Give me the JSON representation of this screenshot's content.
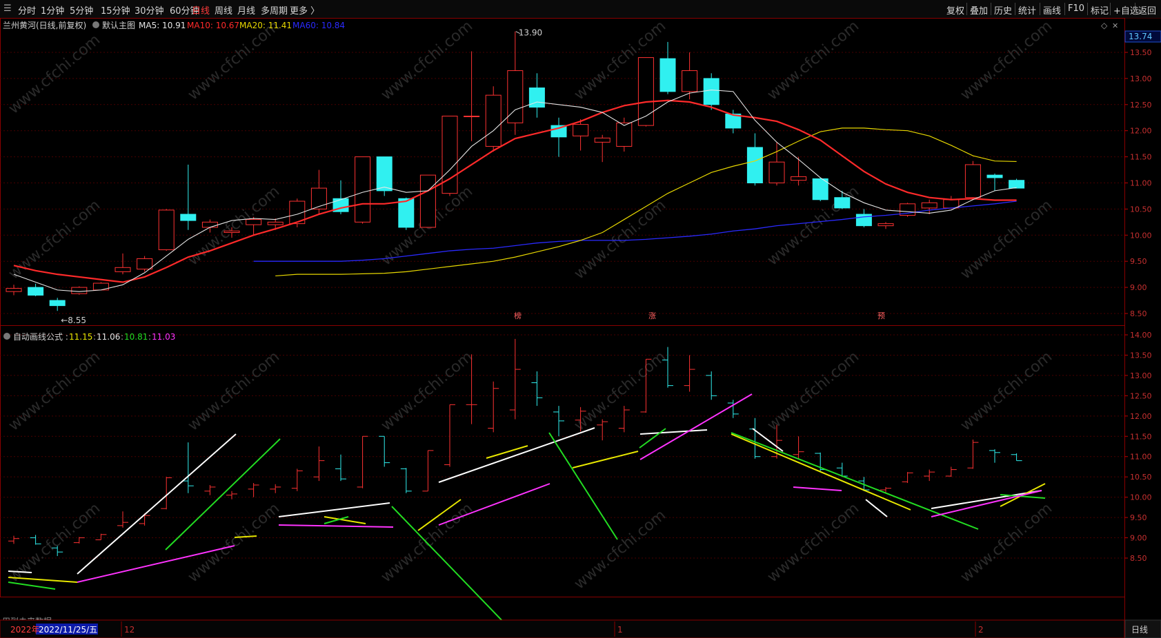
{
  "toolbar": {
    "timeframes": [
      {
        "label": "分时",
        "active": false
      },
      {
        "label": "1分钟",
        "active": false
      },
      {
        "label": "5分钟",
        "active": false
      },
      {
        "label": "15分钟",
        "active": false
      },
      {
        "label": "30分钟",
        "active": false
      },
      {
        "label": "60分钟",
        "active": false
      },
      {
        "label": "日线",
        "active": true
      },
      {
        "label": "周线",
        "active": false
      },
      {
        "label": "月线",
        "active": false
      },
      {
        "label": "多周期",
        "active": false
      },
      {
        "label": "更多 〉",
        "active": false
      }
    ],
    "right_buttons": [
      "复权",
      "叠加",
      "历史",
      "统计",
      "画线",
      "F10",
      "标记",
      "+自选",
      "返回"
    ]
  },
  "main_panel": {
    "title": "兰州黄河(日线,前复权)",
    "template_label": "默认主图",
    "ma": [
      {
        "label": "MA5: 10.91",
        "color": "#e6e6e6"
      },
      {
        "label": "MA10: 10.67",
        "color": "#ff2a2a"
      },
      {
        "label": "MA20: 11.41",
        "color": "#e8d800"
      },
      {
        "label": "MA60: 10.84",
        "color": "#2a2aff"
      }
    ],
    "current_price": "13.74",
    "price_axis": [
      "13.50",
      "13.00",
      "12.50",
      "12.00",
      "11.50",
      "11.00",
      "10.50",
      "10.00",
      "9.50",
      "9.00",
      "8.50"
    ],
    "high_label": "13.90",
    "low_label": "8.55",
    "markers": [
      "榜",
      "涨",
      "预"
    ]
  },
  "sub_panel": {
    "title": "自动画线公式",
    "values": [
      {
        "label": "11.15",
        "color": "#e8e800"
      },
      {
        "label": "11.06",
        "color": "#e6e6e6"
      },
      {
        "label": "10.81",
        "color": "#22dd22"
      },
      {
        "label": "11.03",
        "color": "#ff33ff"
      }
    ],
    "price_axis": [
      "14.00",
      "13.50",
      "13.00",
      "12.50",
      "12.00",
      "11.50",
      "11.00",
      "10.50",
      "10.00",
      "9.50",
      "9.00",
      "8.50"
    ],
    "note": "用到未来数据"
  },
  "date_bar": {
    "year": "2022年",
    "cursor_date": "2022/11/25/五",
    "months": [
      "12",
      "1",
      "2"
    ],
    "period": "日线"
  },
  "watermark": "www.cfchi.com",
  "chart_data": {
    "type": "candlestick",
    "candles": [
      {
        "o": 8.92,
        "h": 9.05,
        "l": 8.85,
        "c": 8.98
      },
      {
        "o": 9.0,
        "h": 9.07,
        "l": 8.83,
        "c": 8.85
      },
      {
        "o": 8.75,
        "h": 8.8,
        "l": 8.55,
        "c": 8.65
      },
      {
        "o": 8.88,
        "h": 9.02,
        "l": 8.86,
        "c": 9.0
      },
      {
        "o": 8.95,
        "h": 9.1,
        "l": 8.95,
        "c": 9.08
      },
      {
        "o": 9.3,
        "h": 9.65,
        "l": 9.25,
        "c": 9.38
      },
      {
        "o": 9.35,
        "h": 9.6,
        "l": 9.3,
        "c": 9.55
      },
      {
        "o": 9.72,
        "h": 10.5,
        "l": 9.7,
        "c": 10.48
      },
      {
        "o": 10.4,
        "h": 11.35,
        "l": 10.1,
        "c": 10.28
      },
      {
        "o": 10.15,
        "h": 10.3,
        "l": 10.05,
        "c": 10.25
      },
      {
        "o": 10.05,
        "h": 10.15,
        "l": 9.95,
        "c": 10.08
      },
      {
        "o": 10.2,
        "h": 10.35,
        "l": 10.0,
        "c": 10.3
      },
      {
        "o": 10.2,
        "h": 10.32,
        "l": 10.1,
        "c": 10.25
      },
      {
        "o": 10.22,
        "h": 10.7,
        "l": 10.15,
        "c": 10.65
      },
      {
        "o": 10.5,
        "h": 11.25,
        "l": 10.4,
        "c": 10.9
      },
      {
        "o": 10.7,
        "h": 11.05,
        "l": 10.4,
        "c": 10.45
      },
      {
        "o": 10.25,
        "h": 11.5,
        "l": 10.22,
        "c": 11.5
      },
      {
        "o": 11.5,
        "h": 11.5,
        "l": 10.75,
        "c": 10.85
      },
      {
        "o": 10.7,
        "h": 10.72,
        "l": 10.1,
        "c": 10.15
      },
      {
        "o": 10.15,
        "h": 11.15,
        "l": 10.15,
        "c": 11.15
      },
      {
        "o": 10.8,
        "h": 12.28,
        "l": 10.75,
        "c": 12.28
      },
      {
        "o": 12.28,
        "h": 13.52,
        "l": 11.8,
        "c": 12.28
      },
      {
        "o": 11.7,
        "h": 12.85,
        "l": 11.6,
        "c": 12.68
      },
      {
        "o": 12.15,
        "h": 13.9,
        "l": 11.92,
        "c": 13.15
      },
      {
        "o": 12.82,
        "h": 13.1,
        "l": 12.25,
        "c": 12.45
      },
      {
        "o": 12.1,
        "h": 12.25,
        "l": 11.5,
        "c": 11.88
      },
      {
        "o": 11.9,
        "h": 12.22,
        "l": 11.62,
        "c": 12.12
      },
      {
        "o": 11.78,
        "h": 11.92,
        "l": 11.4,
        "c": 11.86
      },
      {
        "o": 11.7,
        "h": 12.25,
        "l": 11.6,
        "c": 12.15
      },
      {
        "o": 12.1,
        "h": 13.4,
        "l": 12.08,
        "c": 13.4
      },
      {
        "o": 13.38,
        "h": 13.7,
        "l": 12.7,
        "c": 12.75
      },
      {
        "o": 12.75,
        "h": 13.5,
        "l": 12.6,
        "c": 13.15
      },
      {
        "o": 13.0,
        "h": 13.1,
        "l": 12.4,
        "c": 12.5
      },
      {
        "o": 12.32,
        "h": 12.4,
        "l": 11.95,
        "c": 12.05
      },
      {
        "o": 11.68,
        "h": 11.95,
        "l": 10.95,
        "c": 11.0
      },
      {
        "o": 11.0,
        "h": 11.78,
        "l": 10.95,
        "c": 11.4
      },
      {
        "o": 11.05,
        "h": 11.5,
        "l": 10.95,
        "c": 11.12
      },
      {
        "o": 11.08,
        "h": 11.1,
        "l": 10.65,
        "c": 10.68
      },
      {
        "o": 10.72,
        "h": 10.85,
        "l": 10.5,
        "c": 10.52
      },
      {
        "o": 10.4,
        "h": 10.5,
        "l": 10.15,
        "c": 10.18
      },
      {
        "o": 10.18,
        "h": 10.25,
        "l": 10.12,
        "c": 10.22
      },
      {
        "o": 10.38,
        "h": 10.62,
        "l": 10.35,
        "c": 10.6
      },
      {
        "o": 10.52,
        "h": 10.68,
        "l": 10.4,
        "c": 10.62
      },
      {
        "o": 10.52,
        "h": 10.75,
        "l": 10.5,
        "c": 10.68
      },
      {
        "o": 10.72,
        "h": 11.42,
        "l": 10.7,
        "c": 11.35
      },
      {
        "o": 11.15,
        "h": 11.18,
        "l": 10.85,
        "c": 11.1
      },
      {
        "o": 11.05,
        "h": 11.08,
        "l": 10.9,
        "c": 10.9
      }
    ],
    "ma5": [
      9.25,
      9.1,
      8.95,
      8.92,
      8.95,
      9.05,
      9.28,
      9.6,
      9.92,
      10.15,
      10.28,
      10.32,
      10.3,
      10.4,
      10.55,
      10.68,
      10.82,
      10.92,
      10.82,
      10.85,
      11.25,
      11.7,
      12.0,
      12.4,
      12.55,
      12.5,
      12.45,
      12.35,
      12.1,
      12.28,
      12.55,
      12.72,
      12.78,
      12.75,
      12.2,
      11.78,
      11.45,
      11.1,
      10.82,
      10.62,
      10.48,
      10.45,
      10.42,
      10.48,
      10.68,
      10.85,
      10.91
    ],
    "ma10": [
      9.42,
      9.32,
      9.25,
      9.2,
      9.15,
      9.1,
      9.2,
      9.38,
      9.58,
      9.7,
      9.85,
      10.0,
      10.12,
      10.25,
      10.4,
      10.52,
      10.6,
      10.6,
      10.65,
      10.85,
      11.08,
      11.35,
      11.62,
      11.85,
      11.95,
      12.05,
      12.18,
      12.35,
      12.48,
      12.55,
      12.58,
      12.55,
      12.45,
      12.3,
      12.25,
      12.18,
      12.02,
      11.82,
      11.52,
      11.22,
      10.98,
      10.82,
      10.72,
      10.68,
      10.7,
      10.67,
      10.67
    ],
    "ma20": [
      9.22,
      9.25,
      9.25,
      9.25,
      9.26,
      9.27,
      9.3,
      9.35,
      9.4,
      9.45,
      9.5,
      9.58,
      9.68,
      9.78,
      9.9,
      10.05,
      10.3,
      10.55,
      10.8,
      11.0,
      11.2,
      11.32,
      11.42,
      11.6,
      11.8,
      11.98,
      12.05,
      12.05,
      12.02,
      12.0,
      11.9,
      11.72,
      11.52,
      11.42,
      11.41
    ],
    "ma20_start": 12,
    "ma60": [
      9.5,
      9.5,
      9.5,
      9.5,
      9.5,
      9.52,
      9.55,
      9.6,
      9.65,
      9.7,
      9.73,
      9.75,
      9.8,
      9.85,
      9.88,
      9.9,
      9.9,
      9.9,
      9.92,
      9.95,
      9.98,
      10.02,
      10.08,
      10.12,
      10.18,
      10.22,
      10.26,
      10.3,
      10.35,
      10.38,
      10.42,
      10.48,
      10.52,
      10.56,
      10.6,
      10.65
    ],
    "ma60_start": 11
  }
}
